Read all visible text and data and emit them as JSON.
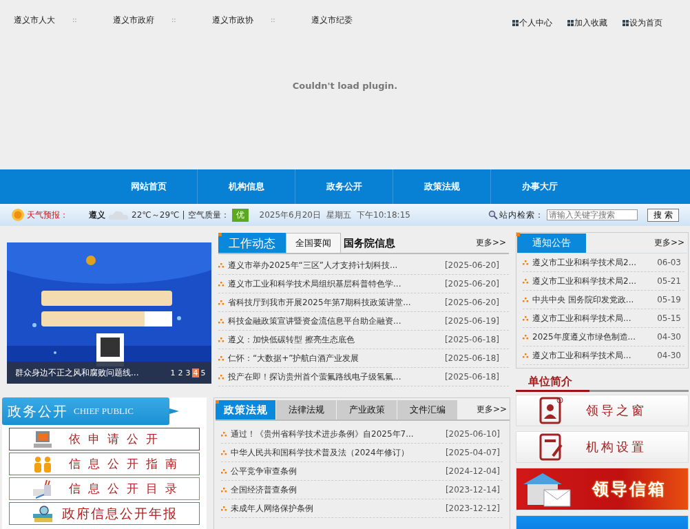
{
  "top_nav": [
    {
      "kind": "link",
      "text": "遵义市人大"
    },
    {
      "kind": "separator",
      "text": "::"
    },
    {
      "kind": "link",
      "text": "遵义市政府"
    },
    {
      "kind": "separator",
      "text": "::"
    },
    {
      "kind": "link",
      "text": "遵义市政协"
    },
    {
      "kind": "separator",
      "text": "::"
    },
    {
      "kind": "link",
      "text": "遵义市纪委"
    }
  ],
  "utility_links": [
    "个人中心",
    "加入收藏",
    "设为首页"
  ],
  "plugin_message": "Couldn't load plugin.",
  "main_nav": [
    "网站首页",
    "机构信息",
    "政务公开",
    "政策法规",
    "办事大厅"
  ],
  "weather": {
    "label": "天气预报：",
    "city": "遵义",
    "temperature": "22℃～29℃",
    "separator": "|",
    "air_quality_label": "空气质量：",
    "air_quality": "优",
    "date": "2025年6月20日",
    "weekday": "星期五",
    "time": "下午10:18:15"
  },
  "search": {
    "label": "站内检索：",
    "placeholder": "请输入关键字搜索",
    "button": "搜 索"
  },
  "slideshow": {
    "kind": "picture",
    "caption": "群众身边不正之风和腐败问题线...",
    "pages": [
      {
        "label": "1",
        "selected": false
      },
      {
        "label": "2",
        "selected": false
      },
      {
        "label": "3",
        "selected": false
      },
      {
        "label": "4",
        "selected": true
      },
      {
        "label": "5",
        "selected": false
      }
    ]
  },
  "news": {
    "tabs": [
      {
        "label": "工作动态",
        "kind": "tab",
        "selected": true
      },
      {
        "label": "全国要闻",
        "kind": "tab",
        "selected": false
      },
      {
        "label": "国务院信息",
        "kind": "plain",
        "selected": false
      }
    ],
    "more": "更多>>",
    "items": [
      {
        "title": "遵义市举办2025年“三区”人才支持计划科技...",
        "date": "[2025-06-20]"
      },
      {
        "title": "遵义市工业和科学技术局组织基层科普特色学...",
        "date": "[2025-06-20]"
      },
      {
        "title": "省科技厅到我市开展2025年第7期科技政策讲堂...",
        "date": "[2025-06-20]"
      },
      {
        "title": "科技金融政策宣讲暨资金流信息平台助企融资...",
        "date": "[2025-06-19]"
      },
      {
        "title": "遵义：加快低碳转型 擦亮生态底色",
        "date": "[2025-06-18]"
      },
      {
        "title": "仁怀：“大数据+”护航白酒产业发展",
        "date": "[2025-06-18]"
      },
      {
        "title": "投产在即！探访贵州首个萤氟路线电子级氢氟...",
        "date": "[2025-06-18]"
      }
    ]
  },
  "notices": {
    "title": "通知公告",
    "more": "更多>>",
    "items": [
      {
        "title": "遵义市工业和科学技术局2...",
        "date": "06-03"
      },
      {
        "title": "遵义市工业和科学技术局2...",
        "date": "05-21"
      },
      {
        "title": "中共中央 国务院印发党政...",
        "date": "05-19"
      },
      {
        "title": "遵义市工业和科学技术局...",
        "date": "05-15"
      },
      {
        "title": "2025年度遵义市绿色制造...",
        "date": "04-30"
      },
      {
        "title": "遵义市工业和科学技术局...",
        "date": "04-30"
      }
    ]
  },
  "unit_intro": {
    "title": "单位简介"
  },
  "open_gov": {
    "title": "政务公开",
    "subtitle": "CHIEF PUBLIC",
    "buttons": [
      {
        "label": "依申请公开",
        "kind": "computer",
        "color": "#b8242c"
      },
      {
        "label": "信息公开指南",
        "kind": "people",
        "color": "#2aa83a"
      },
      {
        "label": "信息公开目录",
        "kind": "pencils",
        "color": "#b08a2a"
      },
      {
        "label": "政府信息公开年报",
        "kind": "books",
        "color": "#1aa888"
      }
    ]
  },
  "policy": {
    "tabs": [
      {
        "label": "政策法规",
        "selected": true
      },
      {
        "label": "法律法规",
        "selected": false
      },
      {
        "label": "产业政策",
        "selected": false
      },
      {
        "label": "文件汇编",
        "selected": false
      }
    ],
    "more": "更多>>",
    "items": [
      {
        "title": "通过！《贵州省科学技术进步条例》自2025年7...",
        "date": "[2025-06-10]"
      },
      {
        "title": "中华人民共和国科学技术普及法（2024年修订）",
        "date": "[2025-04-07]"
      },
      {
        "title": "公平竞争审查条例",
        "date": "[2024-12-04]"
      },
      {
        "title": "全国经济普查条例",
        "date": "[2023-12-14]"
      },
      {
        "title": "未成年人网络保护条例",
        "date": "[2023-12-12]"
      }
    ]
  },
  "quick_links": [
    {
      "kind": "contacts",
      "label": "领导之窗"
    },
    {
      "kind": "notes",
      "label": "机构设置"
    },
    {
      "kind": "mailbox",
      "label": "领导信箱"
    },
    {
      "kind": "banner"
    }
  ]
}
